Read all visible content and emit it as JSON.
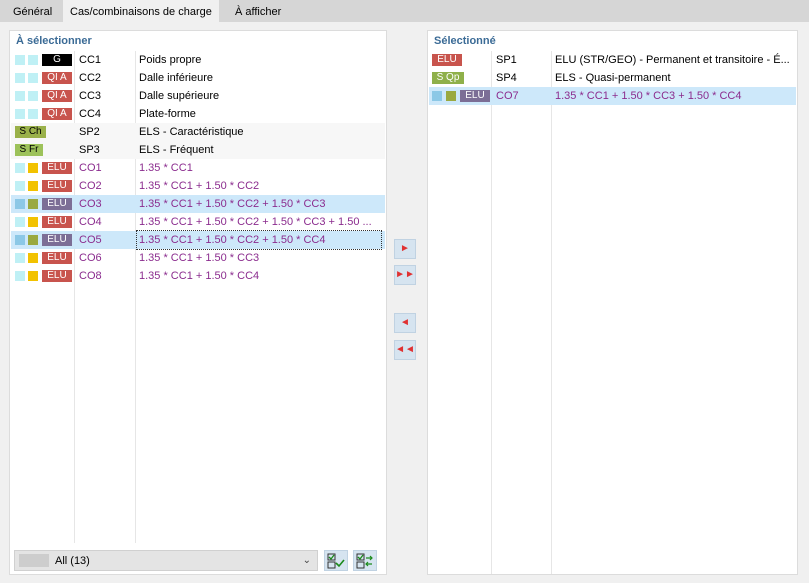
{
  "tabs": [
    {
      "label": "Général"
    },
    {
      "label": "Cas/combinaisons de charge"
    },
    {
      "label": "À afficher"
    }
  ],
  "colors": {
    "badge_black": "#000000",
    "badge_red": "#c8544d",
    "badge_green": "#9ab14a",
    "badge_green_light": "#9dc25a",
    "badge_purple": "#7c6e96",
    "square_cyan": "#bff0f5",
    "square_yellow": "#f2c200",
    "square_olive": "#9aa940",
    "square_blue": "#8cc8e6",
    "arrow_red": "#e03232",
    "selection_blue": "#cde8fa"
  },
  "left": {
    "title": "À sélectionner",
    "rows": [
      {
        "badge": "G",
        "code": "CC1",
        "desc": "Poids propre"
      },
      {
        "badge": "QI A",
        "code": "CC2",
        "desc": "Dalle inférieure"
      },
      {
        "badge": "QI A",
        "code": "CC3",
        "desc": "Dalle supérieure"
      },
      {
        "badge": "QI A",
        "code": "CC4",
        "desc": "Plate-forme"
      },
      {
        "badge": "S Ch",
        "code": "SP2",
        "desc": "ELS - Caractéristique"
      },
      {
        "badge": "S Fr",
        "code": "SP3",
        "desc": "ELS - Fréquent"
      },
      {
        "badge": "ELU",
        "code": "CO1",
        "desc": "1.35 * CC1"
      },
      {
        "badge": "ELU",
        "code": "CO2",
        "desc": "1.35 * CC1 + 1.50 * CC2"
      },
      {
        "badge": "ELU",
        "code": "CO3",
        "desc": "1.35 * CC1 + 1.50 * CC2 + 1.50 * CC3"
      },
      {
        "badge": "ELU",
        "code": "CO4",
        "desc": "1.35 * CC1 + 1.50 * CC2 + 1.50 * CC3 + 1.50 ..."
      },
      {
        "badge": "ELU",
        "code": "CO5",
        "desc": "1.35 * CC1 + 1.50 * CC2 + 1.50 * CC4"
      },
      {
        "badge": "ELU",
        "code": "CO6",
        "desc": "1.35 * CC1 + 1.50 * CC3"
      },
      {
        "badge": "ELU",
        "code": "CO8",
        "desc": "1.35 * CC1 + 1.50 * CC4"
      }
    ],
    "filter": {
      "value": "All (13)",
      "icon": "chevron-down-icon"
    }
  },
  "right": {
    "title": "Sélectionné",
    "rows": [
      {
        "badge": "ELU",
        "code": "SP1",
        "desc": "ELU (STR/GEO) - Permanent et transitoire - É..."
      },
      {
        "badge": "S Qp",
        "code": "SP4",
        "desc": "ELS - Quasi-permanent"
      },
      {
        "badge": "ELU",
        "code": "CO7",
        "desc": "1.35 * CC1 + 1.50 * CC3 + 1.50 * CC4"
      }
    ]
  },
  "buttons": {
    "add_one": "►",
    "add_all": "►►",
    "remove_one": "◄",
    "remove_all": "◄◄",
    "select_all_icon": "check-all-icon",
    "toggle_icon": "toggle-selection-icon"
  }
}
